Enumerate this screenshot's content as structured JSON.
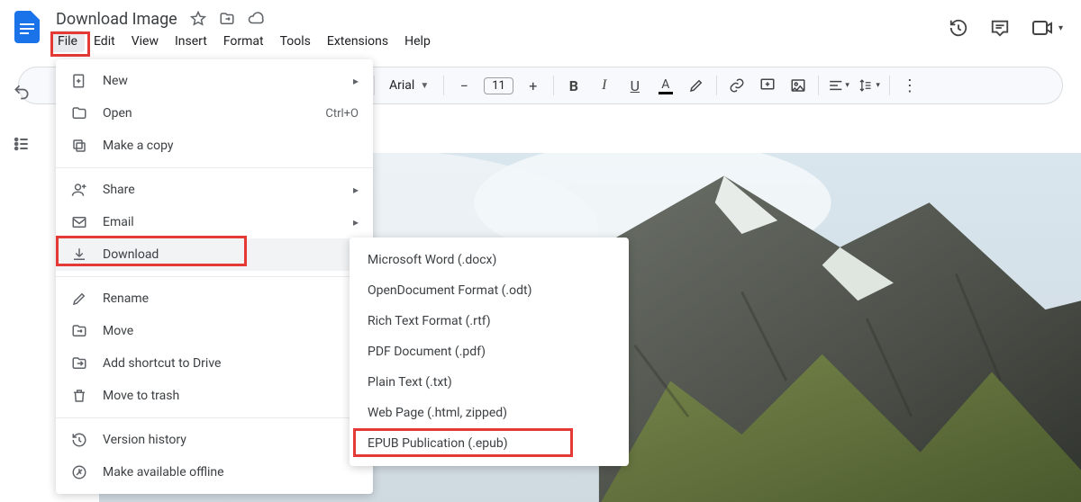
{
  "doc": {
    "title": "Download Image"
  },
  "menubar": [
    "File",
    "Edit",
    "View",
    "Insert",
    "Format",
    "Tools",
    "Extensions",
    "Help"
  ],
  "toolbar": {
    "font": "Arial",
    "size": "11"
  },
  "file_menu": {
    "items_top": [
      {
        "icon": "plus-doc",
        "label": "New",
        "arrow": true
      },
      {
        "icon": "folder",
        "label": "Open",
        "shortcut": "Ctrl+O"
      },
      {
        "icon": "copy",
        "label": "Make a copy"
      }
    ],
    "items_mid": [
      {
        "icon": "person-plus",
        "label": "Share",
        "arrow": true
      },
      {
        "icon": "mail",
        "label": "Email",
        "arrow": true
      },
      {
        "icon": "download",
        "label": "Download",
        "arrow": true,
        "hover": true
      }
    ],
    "items_mid2": [
      {
        "icon": "pencil",
        "label": "Rename"
      },
      {
        "icon": "move",
        "label": "Move"
      },
      {
        "icon": "shortcut",
        "label": "Add shortcut to Drive"
      },
      {
        "icon": "trash",
        "label": "Move to trash"
      }
    ],
    "items_bot": [
      {
        "icon": "history",
        "label": "Version history",
        "arrow": true
      },
      {
        "icon": "offline",
        "label": "Make available offline"
      }
    ]
  },
  "download_submenu": [
    "Microsoft Word (.docx)",
    "OpenDocument Format (.odt)",
    "Rich Text Format (.rtf)",
    "PDF Document (.pdf)",
    "Plain Text (.txt)",
    "Web Page (.html, zipped)",
    "EPUB Publication (.epub)"
  ]
}
